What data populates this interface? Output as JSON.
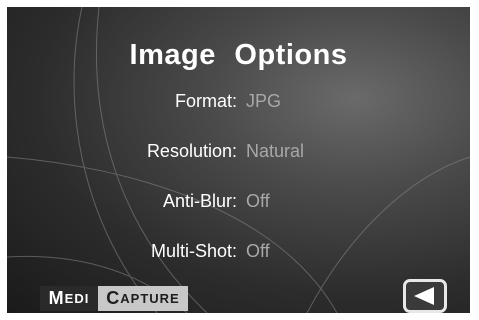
{
  "screen": {
    "title": "Image  Options",
    "options": [
      {
        "label": "Format:",
        "value": "JPG"
      },
      {
        "label": "Resolution:",
        "value": "Natural"
      },
      {
        "label": "Anti-Blur:",
        "value": "Off"
      },
      {
        "label": "Multi-Shot:",
        "value": "Off"
      }
    ]
  },
  "logo": {
    "part1_initial": "M",
    "part1_rest": "EDI",
    "part2_initial": "C",
    "part2_rest": "APTURE"
  },
  "icons": {
    "back": "back-arrow-icon"
  },
  "colors": {
    "background": "#2c2c2c",
    "label": "#ffffff",
    "value": "#a8a8a8"
  }
}
